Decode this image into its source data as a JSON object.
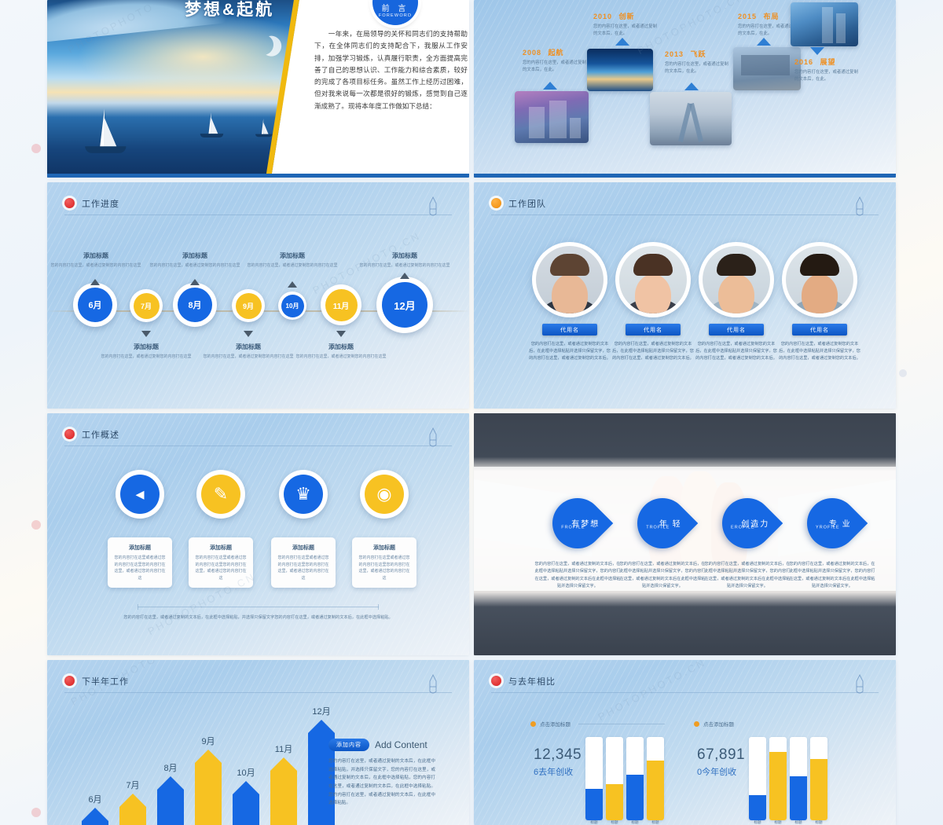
{
  "cover": {
    "title": "梦想&起航",
    "foreword_cn": "前 言",
    "foreword_en": "FOREWORD",
    "body": "　　一年来，在局领导的关怀和同志们的支持帮助下，在全体同志们的支持配合下，我服从工作安排，加强学习锻炼，认真履行职责，全方面提高完善了自己的思想认识、工作能力和综合素质，较好的完成了各项目标任务。虽然工作上经历过困难，但对我来说每一次都是很好的锻炼，感觉到自己逐渐成熟了。现将本年度工作做如下总结："
  },
  "milestones": {
    "items": [
      {
        "year": "2008",
        "label": "起航",
        "desc": "您的内容打在这里，或者通过复制的文本后，在此。"
      },
      {
        "year": "2010",
        "label": "创新",
        "desc": "您的内容打在这里，或者通过复制的文本后，在此。"
      },
      {
        "year": "2013",
        "label": "飞跃",
        "desc": "您的内容打在这里，或者通过复制的文本后，在此。"
      },
      {
        "year": "2015",
        "label": "布局",
        "desc": "您的内容打在这里，或者通过复制的文本后，在此。"
      },
      {
        "year": "2016",
        "label": "展望",
        "desc": "您的内容打在这里，或者通过复制的文本后，在此。"
      }
    ]
  },
  "progress": {
    "title": "工作进度",
    "nodes": [
      {
        "month": "6月",
        "color": "blue"
      },
      {
        "month": "7月",
        "color": "yellow"
      },
      {
        "month": "8月",
        "color": "blue"
      },
      {
        "month": "9月",
        "color": "yellow"
      },
      {
        "month": "10月",
        "color": "blue"
      },
      {
        "month": "11月",
        "color": "yellow"
      },
      {
        "month": "12月",
        "color": "blue"
      }
    ],
    "captions": [
      {
        "title": "添加标题",
        "desc": "您的内容打在这里，或者通过复制您的内容打在这里"
      },
      {
        "title": "添加标题",
        "desc": "您的内容打在这里，或者通过复制您的内容打在这里"
      },
      {
        "title": "添加标题",
        "desc": "您的内容打在这里，或者通过复制您的内容打在这里"
      },
      {
        "title": "添加标题",
        "desc": "您的内容打在这里，或者通过复制您的内容打在这里"
      },
      {
        "title": "添加标题",
        "desc": "您的内容打在这里，或者通过复制您的内容打在这里"
      },
      {
        "title": "添加标题",
        "desc": "您的内容打在这里，或者通过复制您的内容打在这里"
      }
    ]
  },
  "team": {
    "title": "工作团队",
    "members": [
      {
        "name": "代用名",
        "desc": "您的内容打在这里，或者通过复制您的文本后，在此框中选择粘贴并选择只保留文字，您的内容打在这里，或者通过复制您的文本后。"
      },
      {
        "name": "代用名",
        "desc": "您的内容打在这里，或者通过复制您的文本后，在此框中选择粘贴并选择只保留文字，您的内容打在这里，或者通过复制您的文本后。"
      },
      {
        "name": "代用名",
        "desc": "您的内容打在这里，或者通过复制您的文本后，在此框中选择粘贴并选择只保留文字，您的内容打在这里，或者通过复制您的文本后。"
      },
      {
        "name": "代用名",
        "desc": "您的内容打在这里，或者通过复制您的文本后，在此框中选择粘贴并选择只保留文字，您的内容打在这里，或者通过复制您的文本后。"
      }
    ]
  },
  "overview": {
    "title": "工作概述",
    "items": [
      {
        "icon": "play-circle-icon",
        "glyph": "◂",
        "color": "blue",
        "title": "添加标题",
        "desc": "您的内容打在这里或者通过您的内容打在这里您的内容打在这里，或者通过您的内容打在这"
      },
      {
        "icon": "document-pen-icon",
        "glyph": "✎",
        "color": "yellow",
        "title": "添加标题",
        "desc": "您的内容打在这里或者通过您的内容打在这里您的内容打在这里，或者通过您的内容打在这"
      },
      {
        "icon": "shield-crown-icon",
        "glyph": "♛",
        "color": "blue",
        "title": "添加标题",
        "desc": "您的内容打在这里或者通过您的内容打在这里您的内容打在这里，或者通过您的内容打在这"
      },
      {
        "icon": "badge-seal-icon",
        "glyph": "◉",
        "color": "yellow",
        "title": "添加标题",
        "desc": "您的内容打在这里或者通过您的内容打在这里您的内容打在这里，或者通过您的内容打在这"
      }
    ],
    "note": "您的内容打在这里，或者通过复制的文本后，在此框中选择粘贴，并选择只保留文字您的内容打在这里，或者通过复制的文本后，在此框中选择粘贴。"
  },
  "values": {
    "items": [
      {
        "cn": "有梦想",
        "en": "FROFILE",
        "desc": "您的内容打在这里，或者通过复制的文本后，在此框中选择粘贴并选择只保留文字，您的内容打在这里，或者通过复制的文本后在此框中选择粘贴并选择只保留文字。"
      },
      {
        "cn": "年 轻",
        "en": "TROFILE",
        "desc": "您的内容打在这里，或者通过复制的文本后，在此框中选择粘贴并选择只保留文字，您的内容打在这里，或者通过复制的文本后在此框中选择粘贴并选择只保留文字。"
      },
      {
        "cn": "创造力",
        "en": "EROFILE",
        "desc": "您的内容打在这里，或者通过复制的文本后，在此框中选择粘贴并选择只保留文字，您的内容打在这里，或者通过复制的文本后在此框中选择粘贴并选择只保留文字。"
      },
      {
        "cn": "专 业",
        "en": "YROFILE",
        "desc": "您的内容打在这里，或者通过复制的文本后，在此框中选择粘贴并选择只保留文字，您的内容打在这里，或者通过复制的文本后在此框中选择粘贴并选择只保留文字。"
      }
    ]
  },
  "secondhalf": {
    "title": "下半年工作",
    "add_pill": "添加内容",
    "add_en": "Add Content",
    "add_body": "您的内容打在这里，或者通过复制的文本后，在此框中选择粘贴，并选择只保留文字，您的内容打在这里，或者通过复制的文本后，在此框中选择粘贴，您的内容打在这里，或者通过复制的文本后，在此框中选择粘贴。您的内容打在这里，或者通过复制的文本后，在此框中选择粘贴。"
  },
  "compare": {
    "title": "与去年相比",
    "groups": [
      {
        "header": "点击添加标题",
        "big": "12,345",
        "sub": "去年创收",
        "sub_prefix": "6",
        "bars": [
          {
            "label": "标题",
            "color": "blue",
            "pct": 38
          },
          {
            "label": "标题",
            "color": "yellow",
            "pct": 43
          },
          {
            "label": "标题",
            "color": "blue",
            "pct": 55
          },
          {
            "label": "标题",
            "color": "yellow",
            "pct": 72
          }
        ]
      },
      {
        "header": "点击添加标题",
        "big": "67,891",
        "sub": "今年创收",
        "sub_prefix": "0",
        "bars": [
          {
            "label": "标题",
            "color": "blue",
            "pct": 30
          },
          {
            "label": "标题",
            "color": "yellow",
            "pct": 82
          },
          {
            "label": "标题",
            "color": "blue",
            "pct": 53
          },
          {
            "label": "标题",
            "color": "yellow",
            "pct": 74
          }
        ]
      }
    ]
  },
  "chart_data": [
    {
      "type": "bar",
      "title": "下半年工作",
      "categories": [
        "6月",
        "7月",
        "8月",
        "9月",
        "10月",
        "11月",
        "12月"
      ],
      "values": [
        14,
        26,
        40,
        62,
        36,
        56,
        88
      ],
      "colors": [
        "blue",
        "yellow",
        "blue",
        "yellow",
        "blue",
        "yellow",
        "blue"
      ],
      "xlabel": "",
      "ylabel": "",
      "ylim": [
        0,
        100
      ],
      "grid": false,
      "legend": "none"
    },
    {
      "type": "bar",
      "title": "与去年相比 · 去年创收",
      "categories": [
        "标题",
        "标题",
        "标题",
        "标题"
      ],
      "values": [
        38,
        43,
        55,
        72
      ],
      "series": [
        {
          "name": "去年创收",
          "values": [
            38,
            43,
            55,
            72
          ]
        }
      ],
      "annotation": "12,345",
      "ylim": [
        0,
        100
      ],
      "grid": false,
      "legend": "none"
    },
    {
      "type": "bar",
      "title": "与去年相比 · 今年创收",
      "categories": [
        "标题",
        "标题",
        "标题",
        "标题"
      ],
      "values": [
        30,
        82,
        53,
        74
      ],
      "series": [
        {
          "name": "今年创收",
          "values": [
            30,
            82,
            53,
            74
          ]
        }
      ],
      "annotation": "67,891",
      "ylim": [
        0,
        100
      ],
      "grid": false,
      "legend": "none"
    }
  ],
  "watermarks": {
    "w1": "PHOTOPHOTO",
    "w2": "PHOTOPHOTO.CN",
    "w3": "PHOTOPHOTO.CN"
  },
  "colors": {
    "blue": "#1668e3",
    "yellow": "#f7c222",
    "orange": "#ef8f20",
    "red": "#d81f1f",
    "title_text": "#2d4a68"
  }
}
